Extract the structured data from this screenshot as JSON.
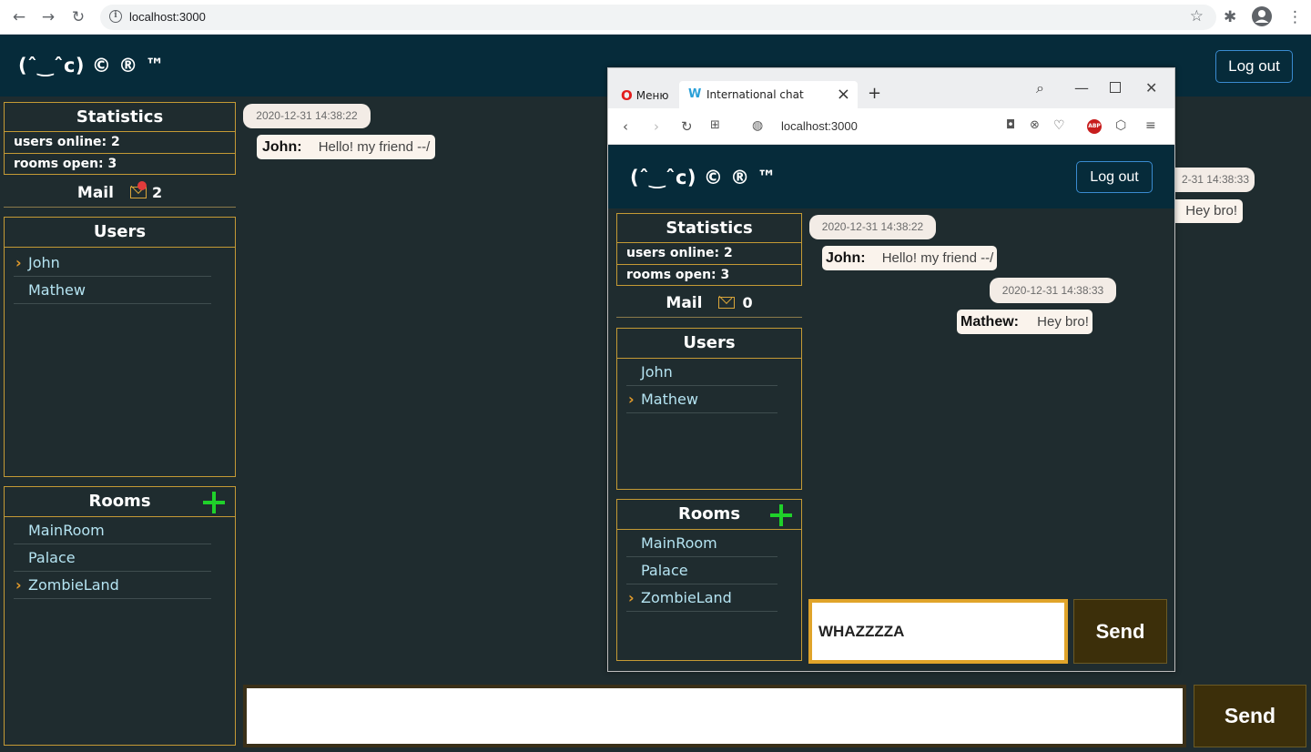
{
  "browser": {
    "url": "localhost:3000"
  },
  "app": {
    "logo": "(ˆ‿ˆc) © ® ™",
    "logout_label": "Log out",
    "statistics_title": "Statistics",
    "users_online": "users online: 2",
    "rooms_open": "rooms open: 3",
    "mail_label": "Mail",
    "mail_count": "2",
    "users_title": "Users",
    "users": [
      {
        "name": "John",
        "active": true
      },
      {
        "name": "Mathew",
        "active": false
      }
    ],
    "rooms_title": "Rooms",
    "rooms": [
      {
        "name": "MainRoom",
        "active": false
      },
      {
        "name": "Palace",
        "active": false
      },
      {
        "name": "ZombieLand",
        "active": true
      }
    ],
    "messages": [
      {
        "date": "2020-12-31 14:38:22",
        "author": "John:",
        "text": "Hello! my friend --/"
      },
      {
        "date": "2-31 14:38:33",
        "author": "",
        "text": "Hey bro!"
      }
    ],
    "input_value": "",
    "send_label": "Send"
  },
  "overlay": {
    "menu_label": "Меню",
    "tab_title": "International chat",
    "url": "localhost:3000",
    "abp_label": "ABP",
    "logo": "(ˆ‿ˆc) © ® ™",
    "logout_label": "Log out",
    "statistics_title": "Statistics",
    "users_online": "users online: 2",
    "rooms_open": "rooms open: 3",
    "mail_label": "Mail",
    "mail_count": "0",
    "users_title": "Users",
    "users": [
      {
        "name": "John",
        "active": false
      },
      {
        "name": "Mathew",
        "active": true
      }
    ],
    "rooms_title": "Rooms",
    "rooms": [
      {
        "name": "MainRoom",
        "active": false
      },
      {
        "name": "Palace",
        "active": false
      },
      {
        "name": "ZombieLand",
        "active": true
      }
    ],
    "messages": [
      {
        "date": "2020-12-31 14:38:22",
        "author": "John:",
        "text": "Hello! my friend --/"
      },
      {
        "date": "2020-12-31 14:38:33",
        "author": "Mathew:",
        "text": "Hey bro!"
      }
    ],
    "input_value": "WHAZZZZA",
    "send_label": "Send"
  },
  "colors": {
    "header_bg": "#062b3a",
    "page_bg": "#1f2c2f",
    "panel_border": "#c49a35",
    "send_bg": "#3c2f0a",
    "add_green": "#1fd12a",
    "notification_red": "#e23b3b"
  }
}
